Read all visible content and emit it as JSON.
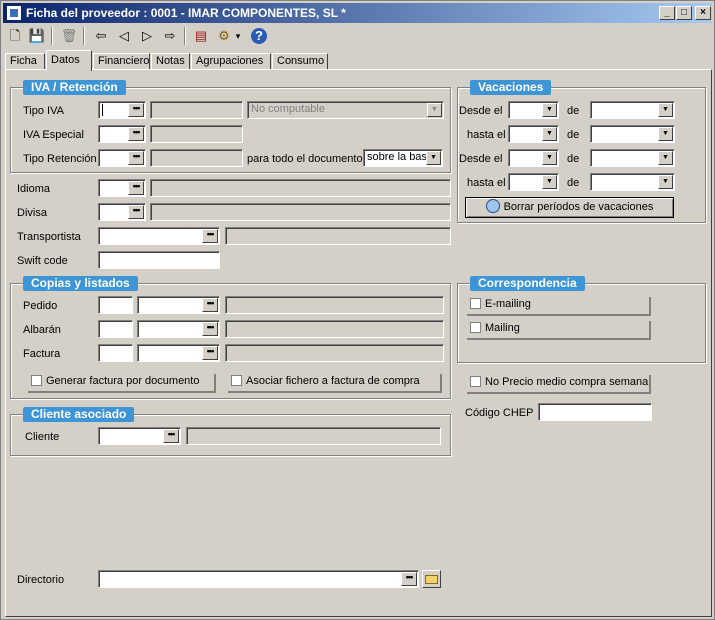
{
  "window": {
    "title": "Ficha del proveedor :  0001 - IMAR COMPONENTES, SL *",
    "min": "_",
    "max": "□",
    "close": "×"
  },
  "toolbar": {
    "new_icon": "🗋",
    "save_icon": "💾",
    "delete_icon": "🗑",
    "first_icon": "⇦",
    "prev_icon": "◁",
    "next_icon": "▷",
    "last_icon": "⇨",
    "report_icon": "▤",
    "tools_icon": "⚙",
    "tools_arrow": "▾",
    "help_icon": "?"
  },
  "tabs": [
    "Ficha",
    "Datos",
    "Financiero",
    "Notas",
    "Agrupaciones",
    "Consumo"
  ],
  "active_tab": "Datos",
  "iva": {
    "group_title": "IVA / Retención",
    "tipo_iva_label": "Tipo IVA",
    "iva_especial_label": "IVA Especial",
    "tipo_retencion_label": "Tipo Retención",
    "no_computable": "No computable",
    "para_todo_label": "para todo el documento",
    "sobre_base": "sobre la base"
  },
  "general": {
    "idioma_label": "Idioma",
    "divisa_label": "Divisa",
    "transportista_label": "Transportista",
    "swift_label": "Swift code"
  },
  "copias": {
    "group_title": "Copias y listados",
    "pedido_label": "Pedido",
    "albaran_label": "Albarán",
    "factura_label": "Factura",
    "generar_label": "Generar factura por documento",
    "asociar_label": "Asociar fichero a factura de compra"
  },
  "cliente": {
    "group_title": "Cliente asociado",
    "cliente_label": "Cliente"
  },
  "directorio_label": "Directorio",
  "vacaciones": {
    "group_title": "Vacaciones",
    "desde_label": "Desde el",
    "hasta_label": "hasta el",
    "de_label": "de",
    "borrar_label": "Borrar períodos de vacaciones"
  },
  "correspondencia": {
    "group_title": "Correspondencia",
    "emailing_label": "E-mailing",
    "mailing_label": "Mailing"
  },
  "no_precio_label": "No Precio medio compra semana",
  "codigo_chep_label": "Código CHEP",
  "icons": {
    "ellipsis": "•••",
    "dropdown": "▼"
  }
}
